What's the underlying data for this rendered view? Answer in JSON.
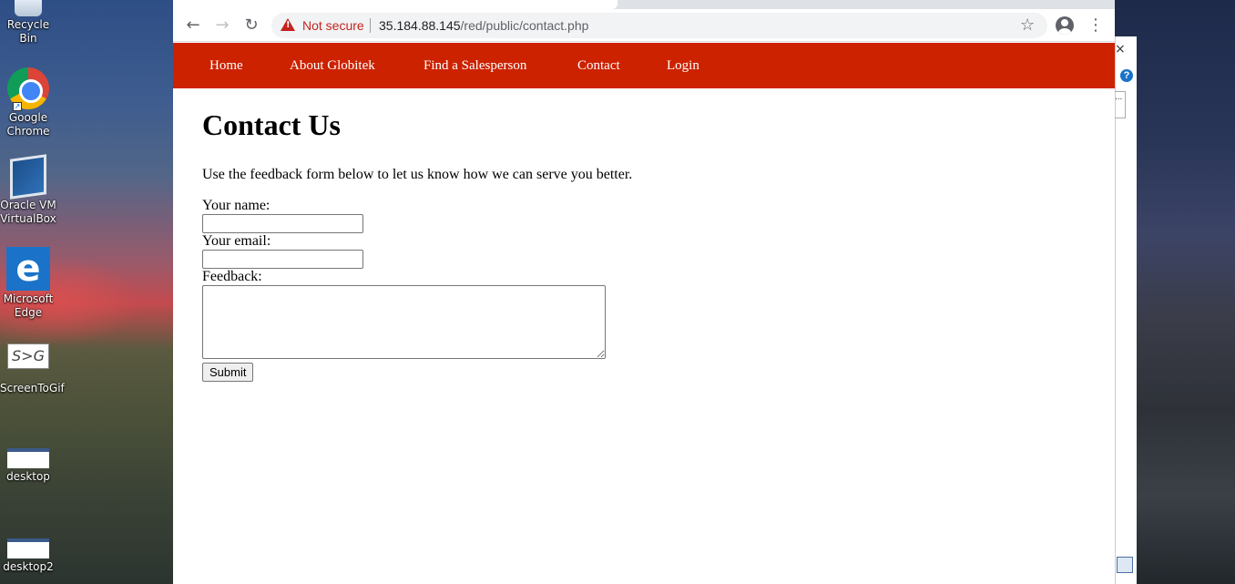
{
  "desktop": {
    "icons": [
      {
        "label": "Recycle Bin",
        "icon": "recycle-bin-icon"
      },
      {
        "label": "Google Chrome",
        "icon": "chrome-icon"
      },
      {
        "label": "Oracle VM VirtualBox",
        "icon": "virtualbox-icon"
      },
      {
        "label": "Microsoft Edge",
        "icon": "edge-icon"
      },
      {
        "label": "ScreenToGif",
        "icon": "screentogif-icon"
      },
      {
        "label": "desktop",
        "icon": "image-file-icon"
      },
      {
        "label": "desktop2",
        "icon": "image-file-icon"
      }
    ],
    "screentogif_glyph": "S>G",
    "edge_glyph": "e"
  },
  "browser": {
    "security_label": "Not secure",
    "url_host": "35.184.88.145",
    "url_path": "/red/public/contact.php",
    "back_glyph": "←",
    "forward_glyph": "→",
    "reload_glyph": "↻",
    "star_glyph": "☆",
    "menu_glyph": "⋮"
  },
  "site": {
    "nav": [
      "Home",
      "About Globitek",
      "Find a Salesperson",
      "Contact",
      "Login"
    ],
    "heading": "Contact Us",
    "intro": "Use the feedback form below to let us know how we can serve you better.",
    "form": {
      "name_label": "Your name:",
      "name_value": "",
      "email_label": "Your email:",
      "email_value": "",
      "feedback_label": "Feedback:",
      "feedback_value": "",
      "submit_label": "Submit"
    },
    "nav_color": "#cc2200"
  },
  "background_window": {
    "close_glyph": "×",
    "help_glyph": "?",
    "field_text": "..."
  }
}
